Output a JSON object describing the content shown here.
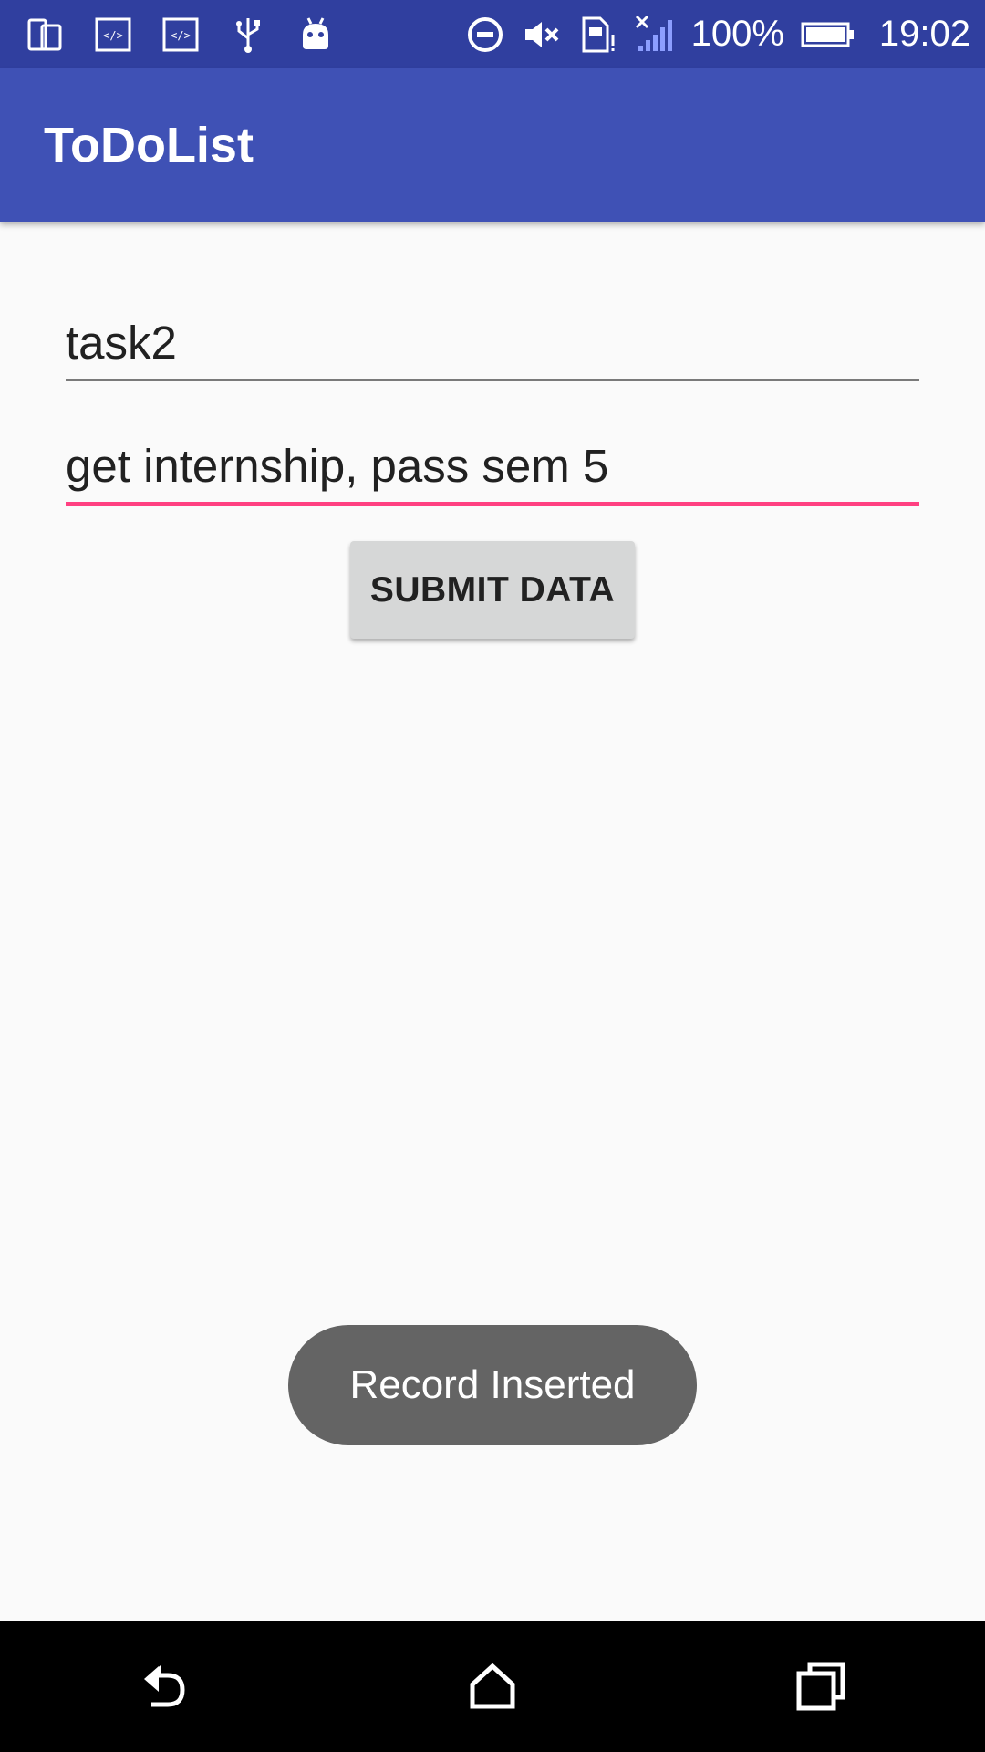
{
  "status_bar": {
    "left_icons": [
      "device-icon",
      "code-icon",
      "code-icon",
      "usb-icon",
      "android-icon"
    ],
    "right_icons": [
      "do-not-disturb-icon",
      "volume-mute-icon",
      "sim-alert-icon",
      "signal-off-icon"
    ],
    "battery_percent": "100%",
    "time": "19:02",
    "background_color": "#303f9f"
  },
  "app_bar": {
    "title": "ToDoList",
    "background_color": "#3f51b5"
  },
  "form": {
    "field_1_value": "task2",
    "field_2_value": "get internship, pass sem 5",
    "focused_underline_color": "#ff4081",
    "submit_label": "SUBMIT DATA"
  },
  "toast": {
    "message": "Record Inserted"
  },
  "nav_bar": {
    "buttons": [
      "back-icon",
      "home-icon",
      "recents-icon"
    ]
  }
}
